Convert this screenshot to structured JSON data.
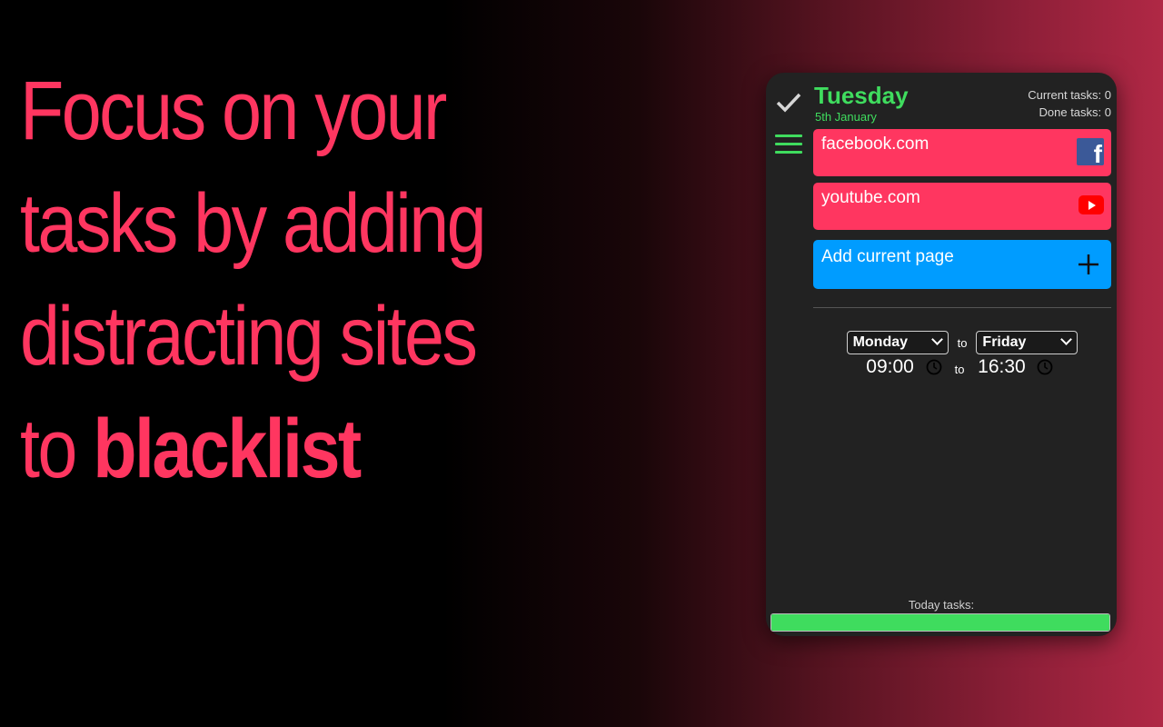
{
  "headline": {
    "lines": [
      "Focus on your",
      "tasks by adding",
      "distracting sites"
    ],
    "last_prefix": "to",
    "last_bold": "blacklist"
  },
  "popup": {
    "day": "Tuesday",
    "date": "5th January",
    "current_tasks": "Current tasks: 0",
    "done_tasks": "Done tasks: 0",
    "sites": [
      {
        "name": "facebook.com",
        "icon": "facebook-icon"
      },
      {
        "name": "youtube.com",
        "icon": "youtube-icon"
      }
    ],
    "add_label": "Add current page",
    "schedule": {
      "from_day": "Monday",
      "to_day": "Friday",
      "to_word": "to",
      "from_time": "09:00",
      "to_time": "16:30"
    },
    "today_label": "Today tasks:",
    "today_progress_percent": 100
  },
  "colors": {
    "accent_red": "#ff3660",
    "accent_green": "#3fdc5e",
    "accent_blue": "#009cff",
    "panel_bg": "#222222"
  }
}
